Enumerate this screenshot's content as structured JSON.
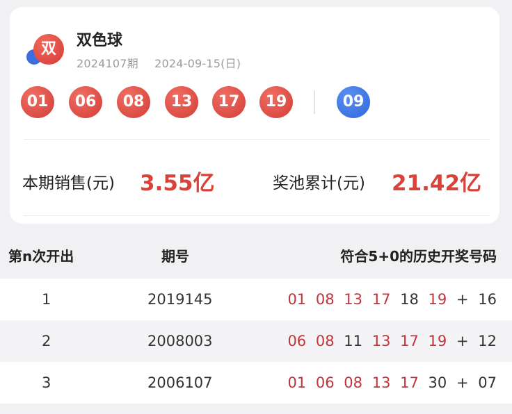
{
  "lottery": {
    "logo_char": "双",
    "name": "双色球",
    "issue": "2024107期",
    "date": "2024-09-15(日)"
  },
  "draw": {
    "red_balls": [
      "01",
      "06",
      "08",
      "13",
      "17",
      "19"
    ],
    "blue_ball": "09"
  },
  "stats": {
    "sales_label": "本期销售(元)",
    "sales_value": "3.55亿",
    "pool_label": "奖池累计(元)",
    "pool_value": "21.42亿"
  },
  "history_table": {
    "headers": [
      "第n次开出",
      "期号",
      "符合5+0的历史开奖号码"
    ],
    "rows": [
      {
        "n": "1",
        "issue": "2019145",
        "reds": [
          {
            "v": "01",
            "hit": true
          },
          {
            "v": "08",
            "hit": true
          },
          {
            "v": "13",
            "hit": true
          },
          {
            "v": "17",
            "hit": true
          },
          {
            "v": "18",
            "hit": false
          },
          {
            "v": "19",
            "hit": true
          }
        ],
        "plus": "+",
        "blue": "16"
      },
      {
        "n": "2",
        "issue": "2008003",
        "reds": [
          {
            "v": "06",
            "hit": true
          },
          {
            "v": "08",
            "hit": true
          },
          {
            "v": "11",
            "hit": false
          },
          {
            "v": "13",
            "hit": true
          },
          {
            "v": "17",
            "hit": true
          },
          {
            "v": "19",
            "hit": true
          }
        ],
        "plus": "+",
        "blue": "12"
      },
      {
        "n": "3",
        "issue": "2006107",
        "reds": [
          {
            "v": "01",
            "hit": true
          },
          {
            "v": "06",
            "hit": true
          },
          {
            "v": "08",
            "hit": true
          },
          {
            "v": "13",
            "hit": true
          },
          {
            "v": "17",
            "hit": true
          },
          {
            "v": "30",
            "hit": false
          }
        ],
        "plus": "+",
        "blue": "07"
      }
    ]
  }
}
